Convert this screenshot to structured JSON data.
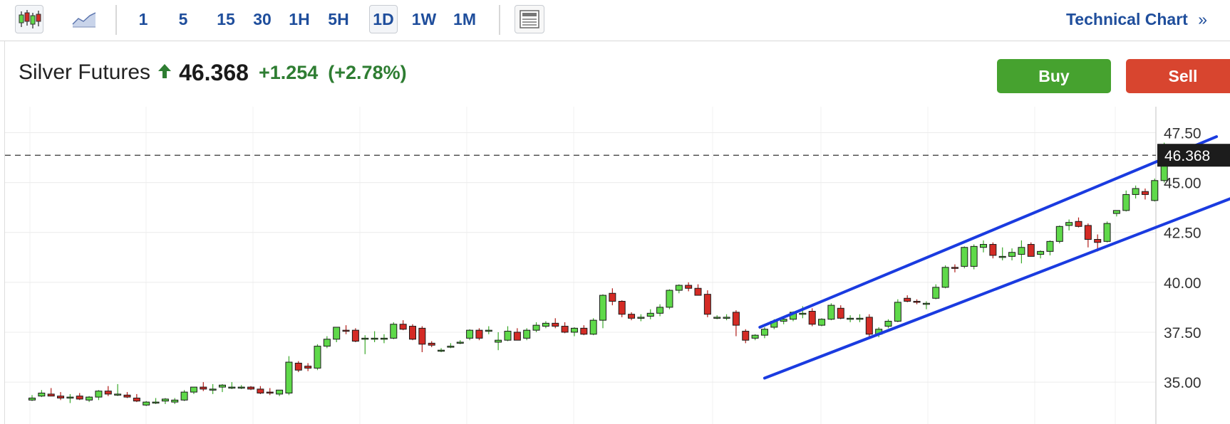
{
  "toolbar": {
    "chart_type_icons": [
      "candlestick-icon",
      "area-chart-icon"
    ],
    "intervals": [
      {
        "label": "1",
        "selected": false
      },
      {
        "label": "5",
        "selected": false
      },
      {
        "label": "15",
        "selected": false
      },
      {
        "label": "30",
        "selected": false
      },
      {
        "label": "1H",
        "selected": false
      },
      {
        "label": "5H",
        "selected": false
      },
      {
        "label": "1D",
        "selected": true
      },
      {
        "label": "1W",
        "selected": false
      },
      {
        "label": "1M",
        "selected": false
      }
    ],
    "layout_icon": "layout-icon",
    "technical_chart_label": "Technical Chart",
    "technical_chart_glyph": "»",
    "accent_color": "#1f4e9c"
  },
  "quote": {
    "instrument": "Silver Futures",
    "direction_icon": "arrow-up-icon",
    "price": "46.368",
    "change": "+1.254",
    "change_percent": "(+2.78%)",
    "positive_color": "#2e7d32"
  },
  "actions": {
    "buy_label": "Buy",
    "sell_label": "Sell",
    "buy_color": "#46a22f",
    "sell_color": "#d8452f"
  },
  "chart_data": {
    "type": "candlestick",
    "y_ticks": [
      "35.00",
      "37.50",
      "40.00",
      "42.50",
      "45.00",
      "47.50"
    ],
    "ylim": [
      32.9,
      48.8
    ],
    "current_price_label": "46.368",
    "current_price": 46.368,
    "grid": true,
    "up_color": "#5fd94a",
    "down_color": "#d42b25",
    "trendline_color": "#1a3be0",
    "candles": [
      [
        34.1,
        34.35,
        34.05,
        34.2
      ],
      [
        34.3,
        34.6,
        34.25,
        34.45
      ],
      [
        34.4,
        34.7,
        34.3,
        34.3
      ],
      [
        34.3,
        34.5,
        34.1,
        34.2
      ],
      [
        34.2,
        34.4,
        33.95,
        34.25
      ],
      [
        34.3,
        34.45,
        34.1,
        34.15
      ],
      [
        34.1,
        34.3,
        34.0,
        34.25
      ],
      [
        34.25,
        34.6,
        34.1,
        34.55
      ],
      [
        34.55,
        34.8,
        34.3,
        34.4
      ],
      [
        34.4,
        34.9,
        34.3,
        34.4
      ],
      [
        34.35,
        34.5,
        34.2,
        34.25
      ],
      [
        34.2,
        34.4,
        34.0,
        34.05
      ],
      [
        33.85,
        34.05,
        33.8,
        34.0
      ],
      [
        34.0,
        34.2,
        33.9,
        34.0
      ],
      [
        34.05,
        34.2,
        33.9,
        34.15
      ],
      [
        34.0,
        34.2,
        33.9,
        34.1
      ],
      [
        34.1,
        34.6,
        34.05,
        34.5
      ],
      [
        34.5,
        34.75,
        34.4,
        34.75
      ],
      [
        34.75,
        35.0,
        34.55,
        34.65
      ],
      [
        34.65,
        34.9,
        34.4,
        34.65
      ],
      [
        34.75,
        34.9,
        34.5,
        34.85
      ],
      [
        34.75,
        35.0,
        34.65,
        34.75
      ],
      [
        34.75,
        34.85,
        34.65,
        34.75
      ],
      [
        34.75,
        34.8,
        34.6,
        34.65
      ],
      [
        34.65,
        34.8,
        34.4,
        34.45
      ],
      [
        34.5,
        34.7,
        34.35,
        34.45
      ],
      [
        34.4,
        34.6,
        34.3,
        34.6
      ],
      [
        34.45,
        36.3,
        34.35,
        36.0
      ],
      [
        35.95,
        36.05,
        35.5,
        35.6
      ],
      [
        35.8,
        35.95,
        35.55,
        35.7
      ],
      [
        35.7,
        36.9,
        35.6,
        36.8
      ],
      [
        36.8,
        37.3,
        36.7,
        37.15
      ],
      [
        37.15,
        37.75,
        37.0,
        37.75
      ],
      [
        37.6,
        37.85,
        37.4,
        37.55
      ],
      [
        37.6,
        37.7,
        37.0,
        37.05
      ],
      [
        37.2,
        37.35,
        36.4,
        37.2
      ],
      [
        37.2,
        37.55,
        37.0,
        37.2
      ],
      [
        37.2,
        37.4,
        36.95,
        37.2
      ],
      [
        37.2,
        38.0,
        37.15,
        37.9
      ],
      [
        37.9,
        38.1,
        37.6,
        37.65
      ],
      [
        37.8,
        37.9,
        37.1,
        37.15
      ],
      [
        37.7,
        37.8,
        36.5,
        36.9
      ],
      [
        36.95,
        37.05,
        36.75,
        36.85
      ],
      [
        36.6,
        36.7,
        36.5,
        36.6
      ],
      [
        36.8,
        36.95,
        36.7,
        36.8
      ],
      [
        37.0,
        37.1,
        36.9,
        37.0
      ],
      [
        37.2,
        37.65,
        37.1,
        37.6
      ],
      [
        37.6,
        37.7,
        37.1,
        37.2
      ],
      [
        37.6,
        37.8,
        37.4,
        37.6
      ],
      [
        37.0,
        37.5,
        36.6,
        37.1
      ],
      [
        37.1,
        37.8,
        37.05,
        37.55
      ],
      [
        37.5,
        37.7,
        37.1,
        37.1
      ],
      [
        37.2,
        37.7,
        37.1,
        37.6
      ],
      [
        37.6,
        38.0,
        37.5,
        37.85
      ],
      [
        37.8,
        38.05,
        37.7,
        37.95
      ],
      [
        37.95,
        38.2,
        37.7,
        37.8
      ],
      [
        37.8,
        38.0,
        37.45,
        37.5
      ],
      [
        37.5,
        37.75,
        37.3,
        37.7
      ],
      [
        37.7,
        37.85,
        37.35,
        37.4
      ],
      [
        37.4,
        38.2,
        37.35,
        38.1
      ],
      [
        38.1,
        39.4,
        37.7,
        39.35
      ],
      [
        39.45,
        39.7,
        38.85,
        39.05
      ],
      [
        39.05,
        39.1,
        38.25,
        38.4
      ],
      [
        38.4,
        38.5,
        38.1,
        38.2
      ],
      [
        38.2,
        38.4,
        38.05,
        38.25
      ],
      [
        38.3,
        38.65,
        38.15,
        38.45
      ],
      [
        38.45,
        38.9,
        38.3,
        38.75
      ],
      [
        38.75,
        39.65,
        38.65,
        39.6
      ],
      [
        39.6,
        39.9,
        39.45,
        39.85
      ],
      [
        39.85,
        40.0,
        39.55,
        39.7
      ],
      [
        39.7,
        39.9,
        39.45,
        39.35
      ],
      [
        39.4,
        39.6,
        38.25,
        38.4
      ],
      [
        38.25,
        38.35,
        38.15,
        38.25
      ],
      [
        38.25,
        38.4,
        38.1,
        38.25
      ],
      [
        38.5,
        38.6,
        37.3,
        37.85
      ],
      [
        37.55,
        37.65,
        36.95,
        37.1
      ],
      [
        37.2,
        37.4,
        37.1,
        37.35
      ],
      [
        37.35,
        37.75,
        37.2,
        37.65
      ],
      [
        37.75,
        38.15,
        37.65,
        38.05
      ],
      [
        38.05,
        38.2,
        37.9,
        38.15
      ],
      [
        38.15,
        38.55,
        38.05,
        38.5
      ],
      [
        38.45,
        38.8,
        38.2,
        38.45
      ],
      [
        38.55,
        38.7,
        37.8,
        37.9
      ],
      [
        37.85,
        38.2,
        37.8,
        38.15
      ],
      [
        38.15,
        38.95,
        38.1,
        38.85
      ],
      [
        38.7,
        38.85,
        38.15,
        38.2
      ],
      [
        38.2,
        38.35,
        38.0,
        38.2
      ],
      [
        38.2,
        38.4,
        38.0,
        38.2
      ],
      [
        38.25,
        38.4,
        37.25,
        37.4
      ],
      [
        37.4,
        37.75,
        37.25,
        37.65
      ],
      [
        37.8,
        38.15,
        37.7,
        38.05
      ],
      [
        38.05,
        39.15,
        38.0,
        39.0
      ],
      [
        39.2,
        39.35,
        39.0,
        39.05
      ],
      [
        39.05,
        39.15,
        38.9,
        39.0
      ],
      [
        38.95,
        39.05,
        38.65,
        38.95
      ],
      [
        39.2,
        39.9,
        39.15,
        39.75
      ],
      [
        39.75,
        40.85,
        39.7,
        40.75
      ],
      [
        40.75,
        40.9,
        40.5,
        40.7
      ],
      [
        40.8,
        41.8,
        40.7,
        41.75
      ],
      [
        40.8,
        41.9,
        40.65,
        41.8
      ],
      [
        41.75,
        42.1,
        41.5,
        41.9
      ],
      [
        41.9,
        42.0,
        41.2,
        41.35
      ],
      [
        41.3,
        41.75,
        41.1,
        41.3
      ],
      [
        41.3,
        41.7,
        41.1,
        41.5
      ],
      [
        41.4,
        42.1,
        40.95,
        41.75
      ],
      [
        41.9,
        42.0,
        41.35,
        41.3
      ],
      [
        41.4,
        41.6,
        41.2,
        41.55
      ],
      [
        41.55,
        42.1,
        41.35,
        42.05
      ],
      [
        42.05,
        42.85,
        41.95,
        42.8
      ],
      [
        42.85,
        43.15,
        42.6,
        43.0
      ],
      [
        43.05,
        43.25,
        42.75,
        42.8
      ],
      [
        42.85,
        42.95,
        41.75,
        42.15
      ],
      [
        42.15,
        42.4,
        41.55,
        42.0
      ],
      [
        42.05,
        43.05,
        42.0,
        42.95
      ],
      [
        43.45,
        43.6,
        43.3,
        43.6
      ],
      [
        43.6,
        44.6,
        43.55,
        44.4
      ],
      [
        44.4,
        44.85,
        44.2,
        44.7
      ],
      [
        44.55,
        44.7,
        44.15,
        44.4
      ],
      [
        44.1,
        45.2,
        44.05,
        45.1
      ],
      [
        45.1,
        47.0,
        45.0,
        46.368
      ]
    ],
    "trendlines": [
      {
        "from": [
          76.5,
          37.75
        ],
        "to": [
          124.5,
          47.3
        ]
      },
      {
        "from": [
          77.0,
          35.2
        ],
        "to": [
          126.0,
          44.2
        ]
      }
    ]
  }
}
